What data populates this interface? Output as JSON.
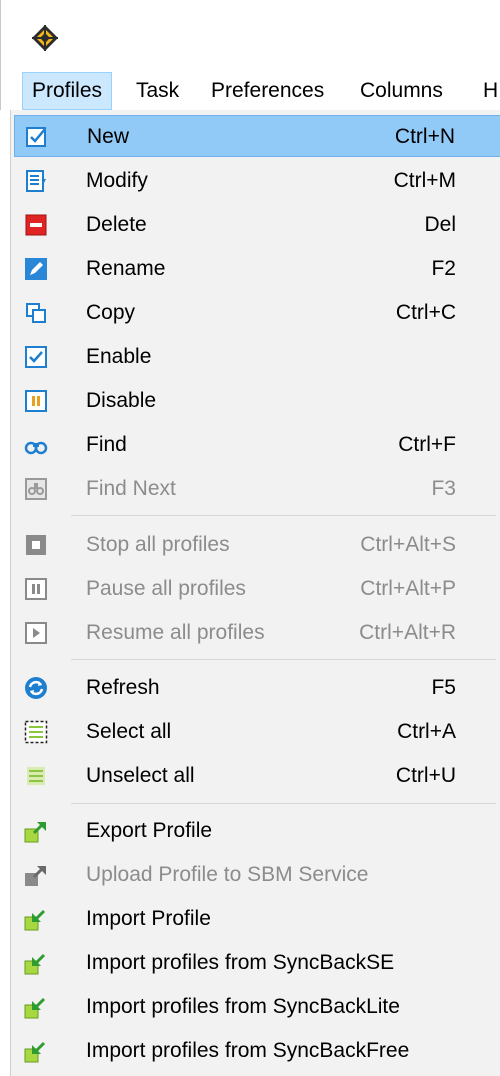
{
  "menubar": {
    "items": [
      {
        "label": "Profiles",
        "active": true
      },
      {
        "label": "Task"
      },
      {
        "label": "Preferences"
      },
      {
        "label": "Columns"
      },
      {
        "label": "H"
      }
    ]
  },
  "profiles_menu": {
    "items": [
      {
        "label": "New",
        "shortcut": "Ctrl+N",
        "icon": "new-profile-icon",
        "highlighted": true
      },
      {
        "label": "Modify",
        "shortcut": "Ctrl+M",
        "icon": "modify-icon"
      },
      {
        "label": "Delete",
        "shortcut": "Del",
        "icon": "delete-icon"
      },
      {
        "label": "Rename",
        "shortcut": "F2",
        "icon": "rename-pencil-icon"
      },
      {
        "label": "Copy",
        "shortcut": "Ctrl+C",
        "icon": "copy-icon"
      },
      {
        "label": "Enable",
        "shortcut": "",
        "icon": "enable-check-icon"
      },
      {
        "label": "Disable",
        "shortcut": "",
        "icon": "disable-pause-icon"
      },
      {
        "label": "Find",
        "shortcut": "Ctrl+F",
        "icon": "find-binoculars-icon"
      },
      {
        "label": "Find Next",
        "shortcut": "F3",
        "icon": "find-next-icon",
        "disabled": true
      },
      {
        "label": "Stop all profiles",
        "shortcut": "Ctrl+Alt+S",
        "icon": "stop-icon",
        "disabled": true
      },
      {
        "label": "Pause all profiles",
        "shortcut": "Ctrl+Alt+P",
        "icon": "pause-icon",
        "disabled": true
      },
      {
        "label": "Resume all profiles",
        "shortcut": "Ctrl+Alt+R",
        "icon": "resume-icon",
        "disabled": true
      },
      {
        "label": "Refresh",
        "shortcut": "F5",
        "icon": "refresh-icon"
      },
      {
        "label": "Select all",
        "shortcut": "Ctrl+A",
        "icon": "select-all-icon"
      },
      {
        "label": "Unselect all",
        "shortcut": "Ctrl+U",
        "icon": "unselect-all-icon"
      },
      {
        "label": "Export Profile",
        "shortcut": "",
        "icon": "export-icon"
      },
      {
        "label": "Upload Profile to SBM Service",
        "shortcut": "",
        "icon": "upload-icon",
        "disabled": true
      },
      {
        "label": "Import Profile",
        "shortcut": "",
        "icon": "import-icon"
      },
      {
        "label": "Import profiles from SyncBackSE",
        "shortcut": "",
        "icon": "import-icon"
      },
      {
        "label": "Import profiles from SyncBackLite",
        "shortcut": "",
        "icon": "import-icon"
      },
      {
        "label": "Import profiles from SyncBackFree",
        "shortcut": "",
        "icon": "import-icon"
      }
    ]
  },
  "colors": {
    "highlight": "#91c9f7",
    "menubar_active": "#cce8ff",
    "menu_background": "#f2f2f2",
    "disabled_text": "#8c8c8c"
  }
}
